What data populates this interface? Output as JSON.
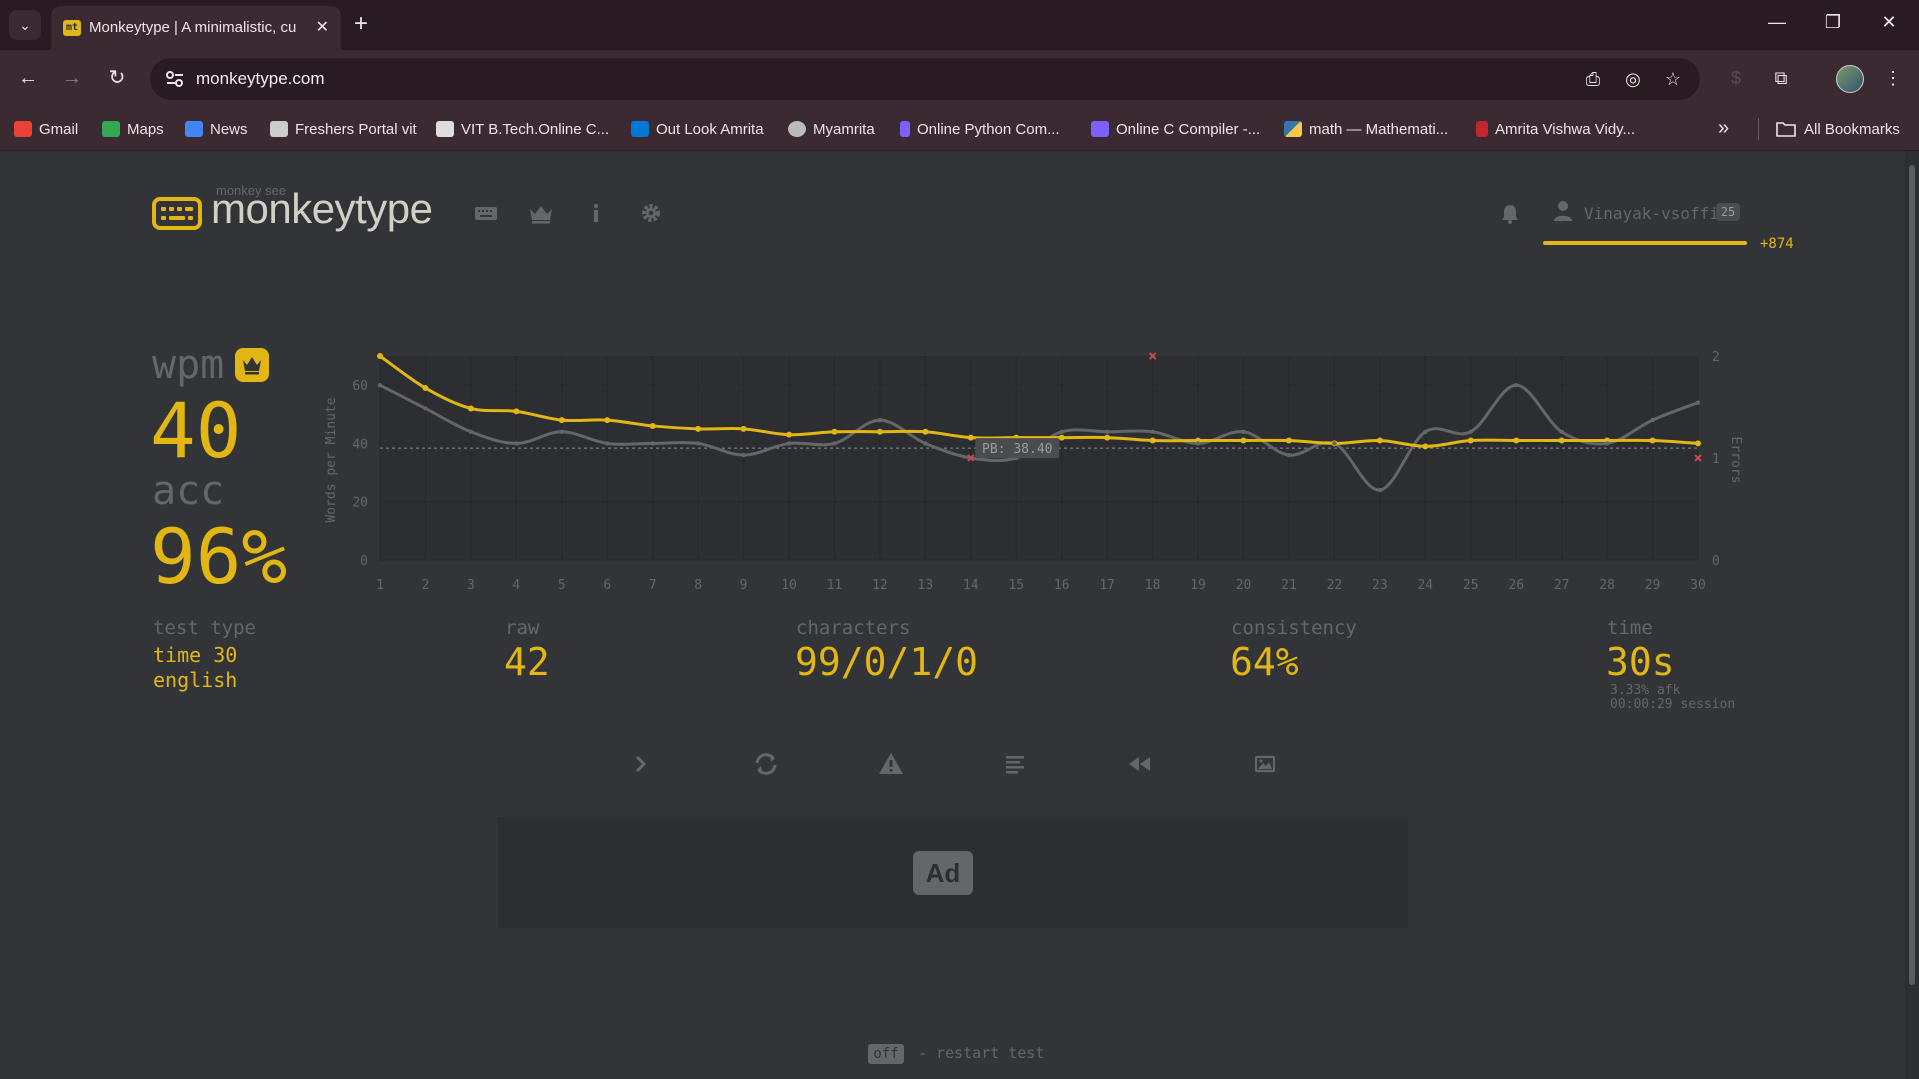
{
  "browser": {
    "tab_title": "Monkeytype | A minimalistic, cu",
    "tab_favicon": "mt",
    "url": "monkeytype.com",
    "bookmarks": [
      {
        "label": "Gmail",
        "color": "#ea4335"
      },
      {
        "label": "Maps",
        "color": "#34a853"
      },
      {
        "label": "News",
        "color": "#4285f4"
      },
      {
        "label": "Freshers Portal vit",
        "color": "#cccccc"
      },
      {
        "label": "VIT B.Tech.Online C...",
        "color": "#dddddd"
      },
      {
        "label": "Out Look Amrita",
        "color": "#0078d4"
      },
      {
        "label": "Myamrita",
        "color": "#bbbbbb"
      },
      {
        "label": "Online Python Com...",
        "color": "#7b61ff"
      },
      {
        "label": "Online C Compiler -...",
        "color": "#7b61ff"
      },
      {
        "label": "math — Mathemati...",
        "color": "#f7c948"
      },
      {
        "label": "Amrita Vishwa Vidy...",
        "color": "#c1272d"
      }
    ],
    "all_bookmarks": "All Bookmarks"
  },
  "header": {
    "logo_small": "monkey see",
    "logo_text": "monkeytype",
    "username": "Vinayak-vsoffi",
    "level": "25",
    "xp_gain": "+874",
    "accent": "#e2b714"
  },
  "result": {
    "wpm_label": "wpm",
    "wpm": "40",
    "acc_label": "acc",
    "acc": "96%",
    "test_type_label": "test type",
    "test_type_1": "time 30",
    "test_type_2": "english",
    "raw_label": "raw",
    "raw": "42",
    "characters_label": "characters",
    "characters": "99/0/1/0",
    "consistency_label": "consistency",
    "consistency": "64%",
    "time_label": "time",
    "time": "30s",
    "afk": "3.33% afk",
    "session": "00:00:29 session"
  },
  "chart_data": {
    "type": "line",
    "x": [
      1,
      2,
      3,
      4,
      5,
      6,
      7,
      8,
      9,
      10,
      11,
      12,
      13,
      14,
      15,
      16,
      17,
      18,
      19,
      20,
      21,
      22,
      23,
      24,
      25,
      26,
      27,
      28,
      29,
      30
    ],
    "x_ticks": [
      "1",
      "2",
      "3",
      "4",
      "5",
      "6",
      "7",
      "8",
      "9",
      "10",
      "11",
      "12",
      "13",
      "14",
      "15",
      "16",
      "17",
      "18",
      "19",
      "20",
      "21",
      "22",
      "23",
      "24",
      "25",
      "26",
      "27",
      "28",
      "29",
      "30"
    ],
    "ylabel": "Words per Minute",
    "ylabel_right": "Errors",
    "ylim": [
      0,
      70
    ],
    "y_ticks": [
      "0",
      "20",
      "40",
      "60"
    ],
    "y2lim": [
      0,
      2
    ],
    "y2_ticks": [
      "0",
      "1",
      "2"
    ],
    "pb_label": "PB: 38.40",
    "pb_value": 38.4,
    "series": [
      {
        "values": [
          70,
          59,
          52,
          51,
          48,
          48,
          46,
          45,
          45,
          43,
          44,
          44,
          44,
          42,
          42,
          42,
          42,
          41,
          41,
          41,
          41,
          40,
          41,
          39,
          41,
          41,
          41,
          41,
          41,
          40
        ],
        "color": "#e2b714"
      },
      {
        "values": [
          60,
          52,
          44,
          40,
          44,
          40,
          40,
          40,
          36,
          40,
          40,
          48,
          40,
          35,
          35,
          44,
          44,
          44,
          40,
          44,
          36,
          40,
          24,
          44,
          44,
          60,
          44,
          40,
          48,
          54
        ],
        "color": "#646669"
      }
    ],
    "errors": [
      {
        "x": 14,
        "y": 1
      },
      {
        "x": 18,
        "y": 2
      },
      {
        "x": 30,
        "y": 1
      }
    ],
    "grid": true
  },
  "footer": {
    "key": "off",
    "hint": "- restart test"
  },
  "ad": {
    "label": "Ad"
  }
}
